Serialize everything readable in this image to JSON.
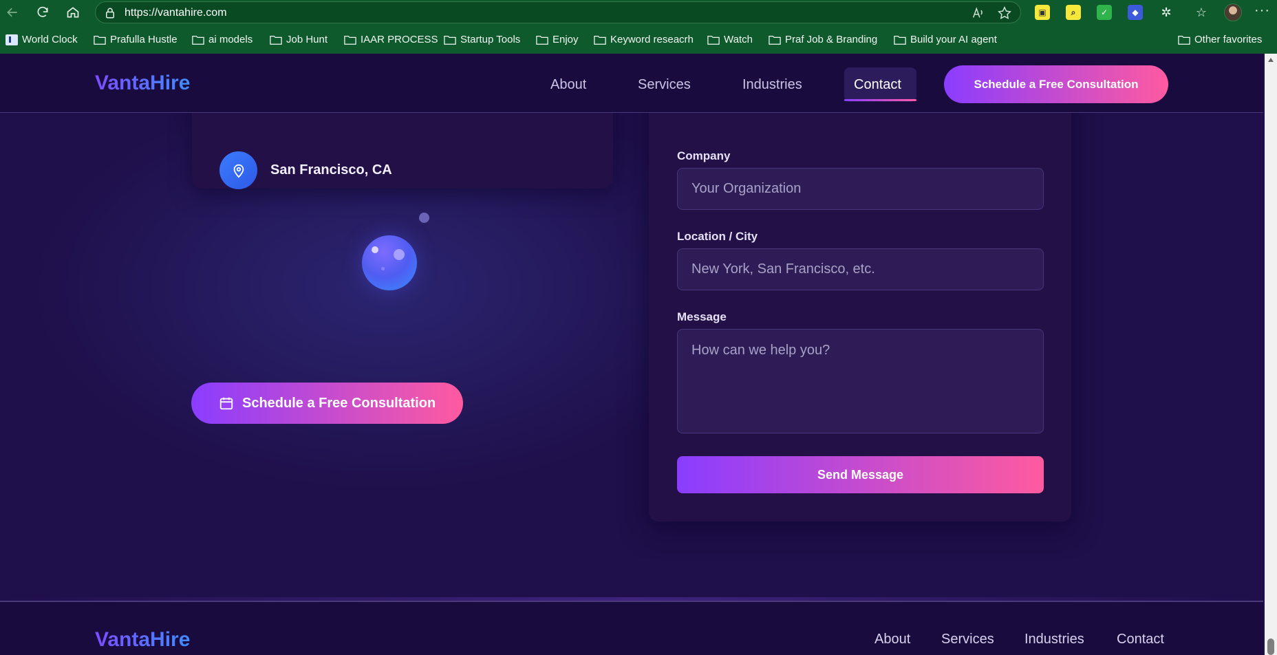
{
  "browser": {
    "url": "https://vantahire.com",
    "bookmarks": [
      "World Clock",
      "Prafulla Hustle",
      "ai models",
      "Job Hunt",
      "IAAR PROCESS",
      "Startup Tools",
      "Enjoy",
      "Keyword reseacrh",
      "Watch",
      "Praf Job & Branding",
      "Build your AI agent"
    ],
    "other_favorites": "Other favorites"
  },
  "header": {
    "logo": "VantaHire",
    "nav": [
      "About",
      "Services",
      "Industries",
      "Contact"
    ],
    "active_nav": "Contact",
    "cta": "Schedule a Free Consultation"
  },
  "contact": {
    "location": "San Francisco, CA"
  },
  "main_cta": "Schedule a Free Consultation",
  "form": {
    "company_label": "Company",
    "company_placeholder": "Your Organization",
    "location_label": "Location / City",
    "location_placeholder": "New York, San Francisco, etc.",
    "message_label": "Message",
    "message_placeholder": "How can we help you?",
    "submit": "Send Message"
  },
  "footer": {
    "logo": "VantaHire",
    "nav": [
      "About",
      "Services",
      "Industries",
      "Contact"
    ]
  },
  "colors": {
    "accent_start": "#8a3dff",
    "accent_end": "#ff5aa0",
    "page_bg": "#1f0f4a",
    "browser_bg": "#0e5a2c"
  }
}
